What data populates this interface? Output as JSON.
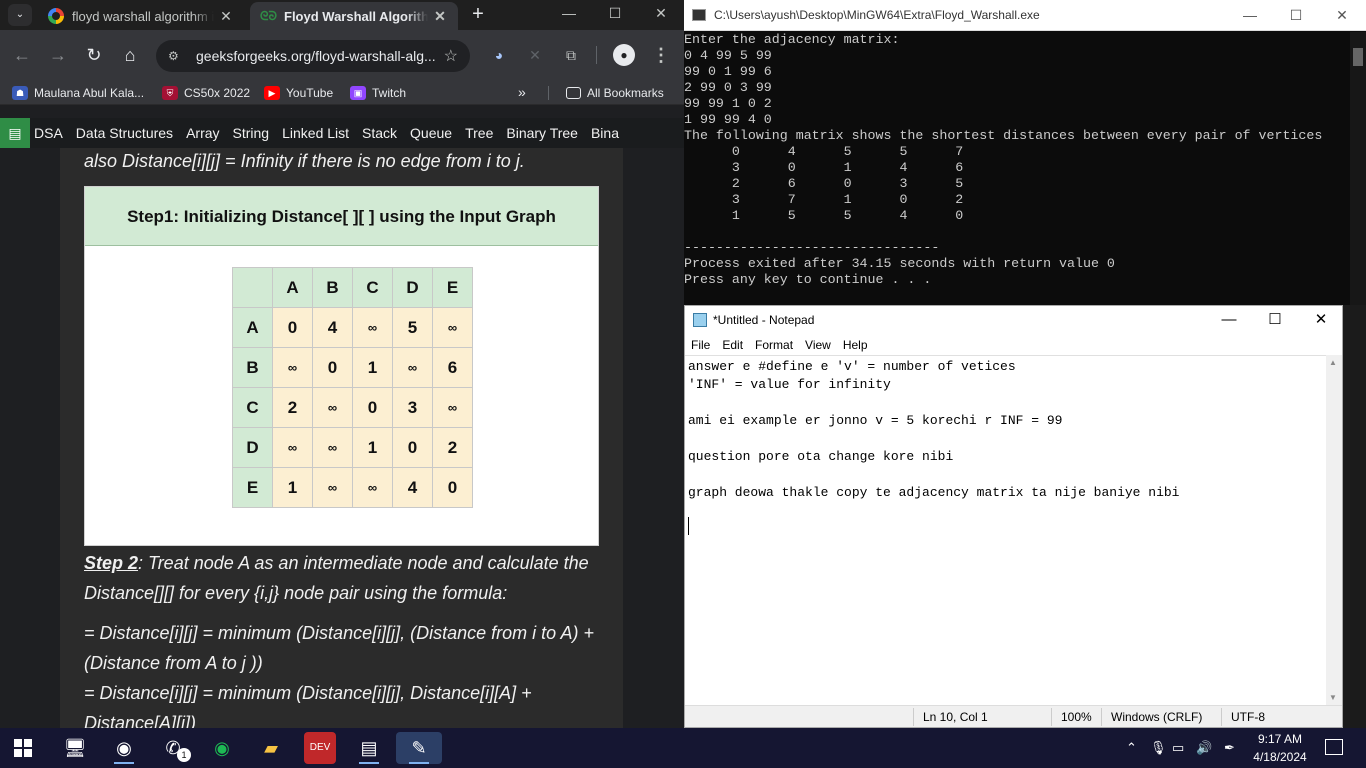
{
  "chrome": {
    "tabs": [
      {
        "title": "floyd warshall algorithm in",
        "active": false
      },
      {
        "title": "Floyd Warshall Algorithm",
        "active": true
      }
    ],
    "url": "geeksforgeeks.org/floyd-warshall-alg...",
    "bookmarks": [
      "Maulana Abul Kala...",
      "CS50x 2022",
      "YouTube",
      "Twitch"
    ],
    "bookmarks_more": "»",
    "all_bookmarks": "All Bookmarks"
  },
  "gfg_nav": [
    "DSA",
    "Data Structures",
    "Array",
    "String",
    "Linked List",
    "Stack",
    "Queue",
    "Tree",
    "Binary Tree",
    "Bina"
  ],
  "article": {
    "top_line": "also Distance[i][j] = Infinity if there is no edge from i to j.",
    "card_title": "Step1: Initializing Distance[ ][ ] using the Input Graph",
    "matrix": {
      "headers": [
        "A",
        "B",
        "C",
        "D",
        "E"
      ],
      "rows": [
        [
          "0",
          "4",
          "∞",
          "5",
          "∞"
        ],
        [
          "∞",
          "0",
          "1",
          "∞",
          "6"
        ],
        [
          "2",
          "∞",
          "0",
          "3",
          "∞"
        ],
        [
          "∞",
          "∞",
          "1",
          "0",
          "2"
        ],
        [
          "1",
          "∞",
          "∞",
          "4",
          "0"
        ]
      ]
    },
    "step2_label": "Step 2",
    "step2_text": ": Treat node A as an intermediate node and calculate the Distance[][] for every {i,j} node pair using the formula:",
    "formula1": "= Distance[i][j] = minimum (Distance[i][j], (Distance from i to A) + (Distance from A to j ))",
    "formula2": "= Distance[i][j] = minimum (Distance[i][j], Distance[i][A] + Distance[A][j])"
  },
  "console": {
    "title": "C:\\Users\\ayush\\Desktop\\MinGW64\\Extra\\Floyd_Warshall.exe",
    "output": "Enter the adjacency matrix:\n0 4 99 5 99\n99 0 1 99 6\n2 99 0 3 99\n99 99 1 0 2\n1 99 99 4 0\nThe following matrix shows the shortest distances between every pair of vertices\n      0      4      5      5      7\n      3      0      1      4      6\n      2      6      0      3      5\n      3      7      1      0      2\n      1      5      5      4      0\n\n--------------------------------\nProcess exited after 34.15 seconds with return value 0\nPress any key to continue . . ."
  },
  "notepad": {
    "title": "*Untitled - Notepad",
    "menu": [
      "File",
      "Edit",
      "Format",
      "View",
      "Help"
    ],
    "text": "answer e #define e 'v' = number of vetices\n'INF' = value for infinity\n\nami ei example er jonno v = 5 korechi r INF = 99\n\nquestion pore ota change kore nibi\n\ngraph deowa thakle copy te adjacency matrix ta nije baniye nibi",
    "status": {
      "position": "Ln 10, Col 1",
      "zoom": "100%",
      "line_endings": "Windows (CRLF)",
      "encoding": "UTF-8"
    }
  },
  "taskbar": {
    "time": "9:17 AM",
    "date": "4/18/2024",
    "whatsapp_badge": "1"
  },
  "colors": {
    "gfg_green": "#2f8d46",
    "header_cell": "#d2ead4",
    "value_cell": "#fcefd2",
    "taskbar": "#151632"
  }
}
